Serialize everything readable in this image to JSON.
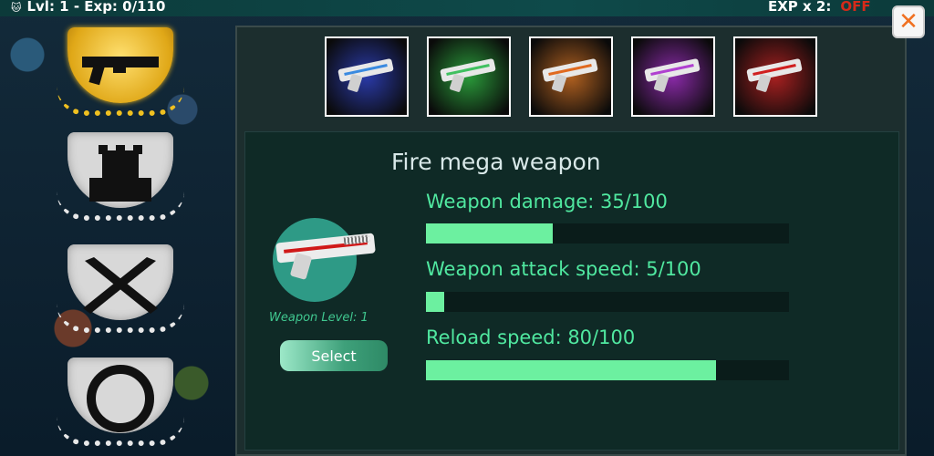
{
  "hud": {
    "level_text": "Lvl: 1 - Exp: 0/110",
    "exp_multiplier_label": "EXP x 2:",
    "exp_multiplier_status": "OFF"
  },
  "sidebar": {
    "items": [
      {
        "name": "weapons",
        "icon": "rifle-icon",
        "selected": true
      },
      {
        "name": "towers",
        "icon": "tower-icon",
        "selected": false
      },
      {
        "name": "melee",
        "icon": "crossed-blades-icon",
        "selected": false
      },
      {
        "name": "rings",
        "icon": "ring-icon",
        "selected": false
      }
    ]
  },
  "weapon_variants": [
    {
      "color_name": "blue",
      "glow": "#2a3aa8",
      "stripe": "#3a8ae0"
    },
    {
      "color_name": "green",
      "glow": "#2a9a3a",
      "stripe": "#40c060"
    },
    {
      "color_name": "orange",
      "glow": "#b06020",
      "stripe": "#e06a20"
    },
    {
      "color_name": "purple",
      "glow": "#8a2aa8",
      "stripe": "#b040d0"
    },
    {
      "color_name": "red",
      "glow": "#a82020",
      "stripe": "#d02020"
    }
  ],
  "weapon": {
    "title": "Fire mega weapon",
    "level_label": "Weapon Level: 1",
    "select_label": "Select",
    "stats": [
      {
        "label": "Weapon damage: 35/100",
        "value": 35,
        "max": 100
      },
      {
        "label": "Weapon attack speed: 5/100",
        "value": 5,
        "max": 100
      },
      {
        "label": "Reload speed: 80/100",
        "value": 80,
        "max": 100
      }
    ]
  },
  "close_icon": "close-icon",
  "colors": {
    "accent": "#50e8a0",
    "off": "#d42a1a",
    "close": "#f07020"
  }
}
